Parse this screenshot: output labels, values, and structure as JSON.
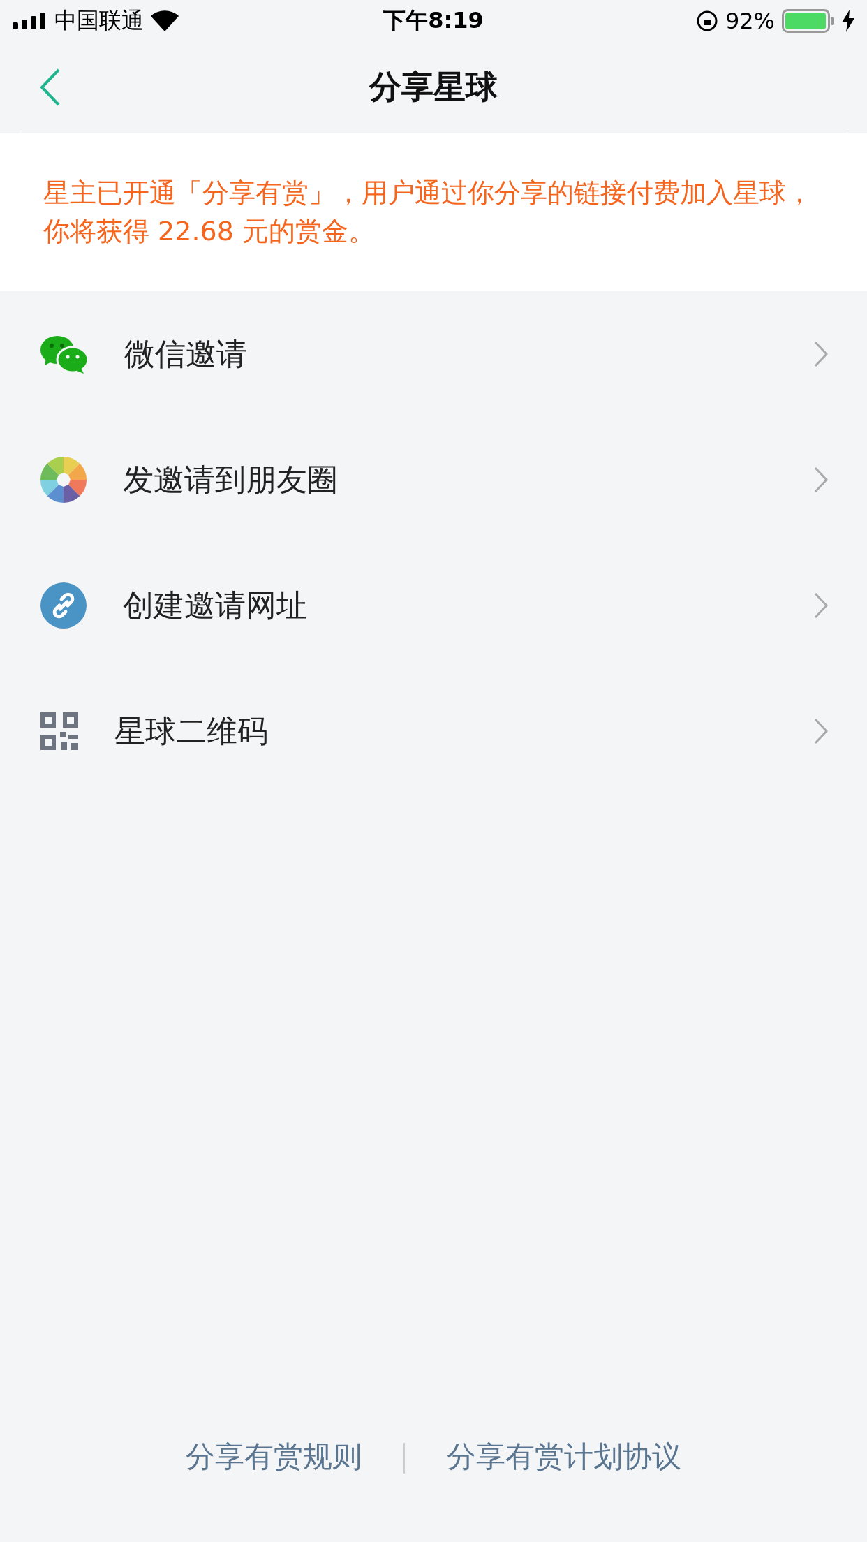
{
  "status_bar": {
    "carrier": "中国联通",
    "time": "下午8:19",
    "battery": "92%"
  },
  "nav": {
    "title": "分享星球"
  },
  "notice": {
    "text": "星主已开通「分享有赏」，用户通过你分享的链接付费加入星球，你将获得 22.68 元的赏金。"
  },
  "items": [
    {
      "kind": "wechat",
      "label": "微信邀请"
    },
    {
      "kind": "moments",
      "label": "发邀请到朋友圈"
    },
    {
      "kind": "link",
      "label": "创建邀请网址"
    },
    {
      "kind": "qrcode",
      "label": "星球二维码"
    }
  ],
  "footer": {
    "links": [
      "分享有赏规则",
      "分享有赏计划协议"
    ]
  }
}
